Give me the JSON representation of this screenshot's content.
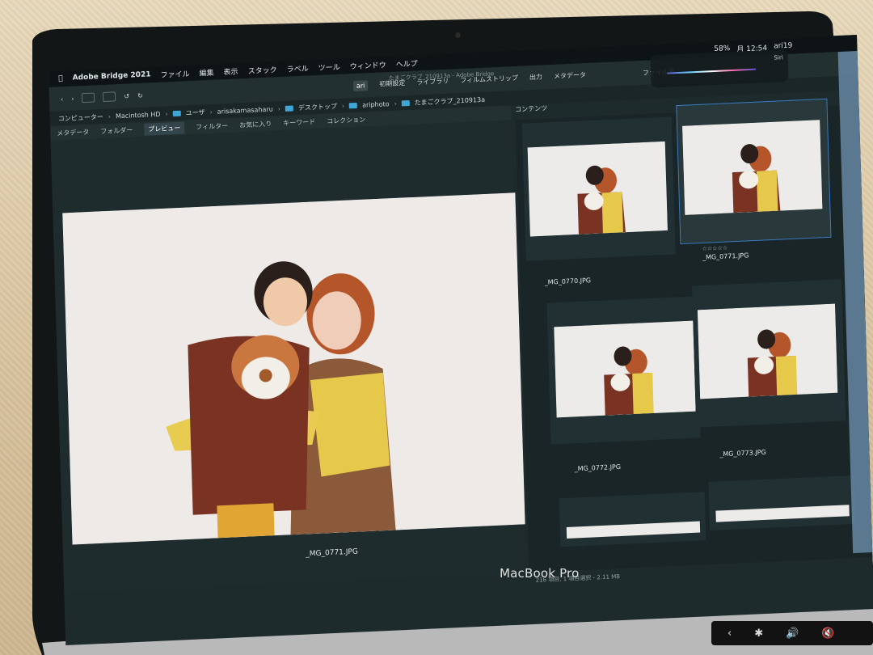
{
  "menubar": {
    "app_name": "Adobe Bridge 2021",
    "items": [
      "ファイル",
      "編集",
      "表示",
      "スタック",
      "ラベル",
      "ツール",
      "ウィンドウ",
      "ヘルプ"
    ],
    "battery": "58%",
    "clock": "月 12:54",
    "user": "ari19"
  },
  "window_title": "たまごクラブ_210913a - Adobe Bridge",
  "toolbar": {
    "workspaces": [
      "ari",
      "初期設定",
      "ライブラリ",
      "フィルムストリップ",
      "出力",
      "メタデータ"
    ],
    "sort_label": "ファイル名"
  },
  "path": [
    "コンピューター",
    "Macintosh HD",
    "ユーザ",
    "arisakamasaharu",
    "デスクトップ",
    "ariphoto",
    "たまごクラブ_210913a"
  ],
  "panel_tabs": [
    "メタデータ",
    "フォルダー",
    "プレビュー",
    "フィルター",
    "お気に入り",
    "キーワード",
    "コレクション"
  ],
  "content_tab": "コンテンツ",
  "preview": {
    "filename": "_MG_0771.JPG"
  },
  "thumbnails": [
    {
      "filename": "_MG_0770.JPG",
      "selected": false
    },
    {
      "filename": "_MG_0771.JPG",
      "selected": true,
      "rating": "☆☆☆☆☆"
    },
    {
      "filename": "_MG_0772.JPG",
      "selected": false
    },
    {
      "filename": "_MG_0773.JPG",
      "selected": false
    }
  ],
  "status": "216 項目, 1 項目選択 - 2.11 MB",
  "siri_label": "Siri",
  "device_brand": "MacBook Pro",
  "colors": {
    "bridge_bg": "#1e2b2d",
    "selection": "#3a7cc1",
    "folder_icon": "#3fa7d6"
  }
}
